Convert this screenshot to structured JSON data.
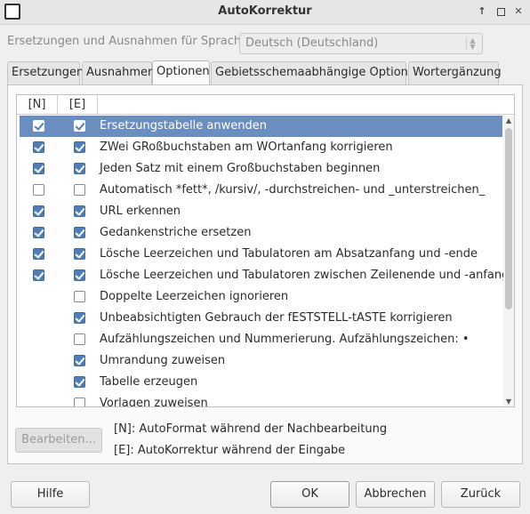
{
  "window": {
    "title": "AutoKorrektur",
    "icons": [
      "app-icon",
      "roll-up-icon",
      "maximize-icon",
      "close-icon"
    ]
  },
  "language": {
    "label": "Ersetzungen und Ausnahmen für Sprache:",
    "value": "Deutsch (Deutschland)"
  },
  "tabs": [
    {
      "label": "Ersetzungen",
      "active": false
    },
    {
      "label": "Ausnahmen",
      "active": false
    },
    {
      "label": "Optionen",
      "active": true
    },
    {
      "label": "Gebietsschemaabhängige Optionen",
      "active": false
    },
    {
      "label": "Wortergänzung",
      "active": false
    }
  ],
  "table": {
    "col_n": "[N]",
    "col_e": "[E]",
    "rows": [
      {
        "label": "Ersetzungstabelle anwenden",
        "n": true,
        "e": true,
        "selected": true
      },
      {
        "label": "ZWei GRoßbuchstaben am WOrtanfang korrigieren",
        "n": true,
        "e": true
      },
      {
        "label": "Jeden Satz mit einem Großbuchstaben beginnen",
        "n": true,
        "e": true
      },
      {
        "label": "Automatisch *fett*, /kursiv/, -durchstreichen- und _unterstreichen_",
        "n": false,
        "e": false
      },
      {
        "label": "URL erkennen",
        "n": true,
        "e": true
      },
      {
        "label": "Gedankenstriche ersetzen",
        "n": true,
        "e": true
      },
      {
        "label": "Lösche Leerzeichen und Tabulatoren am Absatzanfang und -ende",
        "n": true,
        "e": true
      },
      {
        "label": "Lösche Leerzeichen und Tabulatoren zwischen Zeilenende und -anfang",
        "n": true,
        "e": true
      },
      {
        "label": "Doppelte Leerzeichen ignorieren",
        "n": null,
        "e": false
      },
      {
        "label": "Unbeabsichtigten Gebrauch der fESTSTELL-tASTE korrigieren",
        "n": null,
        "e": true
      },
      {
        "label": "Aufzählungszeichen und Nummerierung. Aufzählungszeichen: •",
        "n": null,
        "e": false
      },
      {
        "label": "Umrandung zuweisen",
        "n": null,
        "e": true
      },
      {
        "label": "Tabelle erzeugen",
        "n": null,
        "e": true
      },
      {
        "label": "Vorlagen zuweisen",
        "n": null,
        "e": false
      }
    ]
  },
  "edit_button": "Bearbeiten...",
  "legend": {
    "n": "[N]: AutoFormat während der Nachbearbeitung",
    "e": "[E]: AutoKorrektur während der Eingabe"
  },
  "buttons": {
    "help": "Hilfe",
    "ok": "OK",
    "cancel": "Abbrechen",
    "back": "Zurück"
  },
  "colors": {
    "selection": "#6a8ebf",
    "checkbox_checked": "#4f7fb4"
  }
}
